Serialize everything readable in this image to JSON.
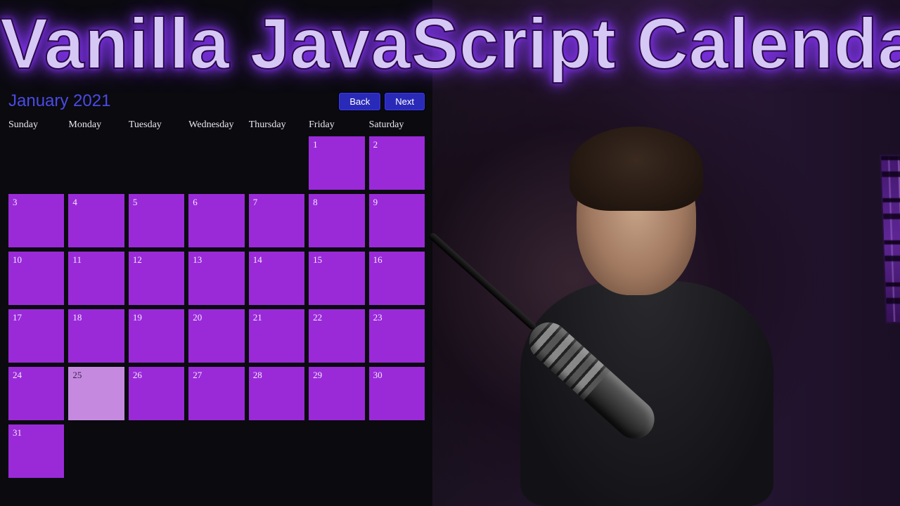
{
  "title": "Vanilla JavaScript Calendar",
  "calendar": {
    "month_label": "January 2021",
    "back_label": "Back",
    "next_label": "Next",
    "weekdays": [
      "Sunday",
      "Monday",
      "Tuesday",
      "Wednesday",
      "Thursday",
      "Friday",
      "Saturday"
    ],
    "padding_days": 5,
    "days_in_month": 31,
    "current_day": 25
  },
  "colors": {
    "day_bg": "#9a2ad8",
    "current_bg": "#c58adf",
    "title_color": "#4a4ae6",
    "button_bg": "#2a2ab8"
  }
}
